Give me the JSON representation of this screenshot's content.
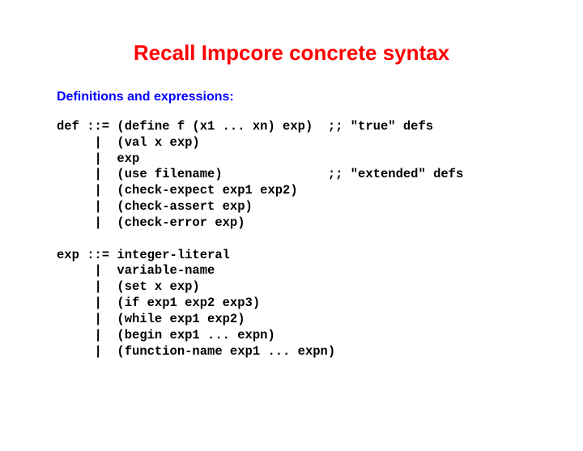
{
  "title": "Recall Impcore concrete syntax",
  "subtitle": "Definitions and expressions:",
  "code": "def ::= (define f (x1 ... xn) exp)  ;; \"true\" defs\n     |  (val x exp)\n     |  exp\n     |  (use filename)              ;; \"extended\" defs\n     |  (check-expect exp1 exp2)\n     |  (check-assert exp)\n     |  (check-error exp)\n\nexp ::= integer-literal\n     |  variable-name\n     |  (set x exp)\n     |  (if exp1 exp2 exp3)\n     |  (while exp1 exp2)\n     |  (begin exp1 ... expn)\n     |  (function-name exp1 ... expn)"
}
